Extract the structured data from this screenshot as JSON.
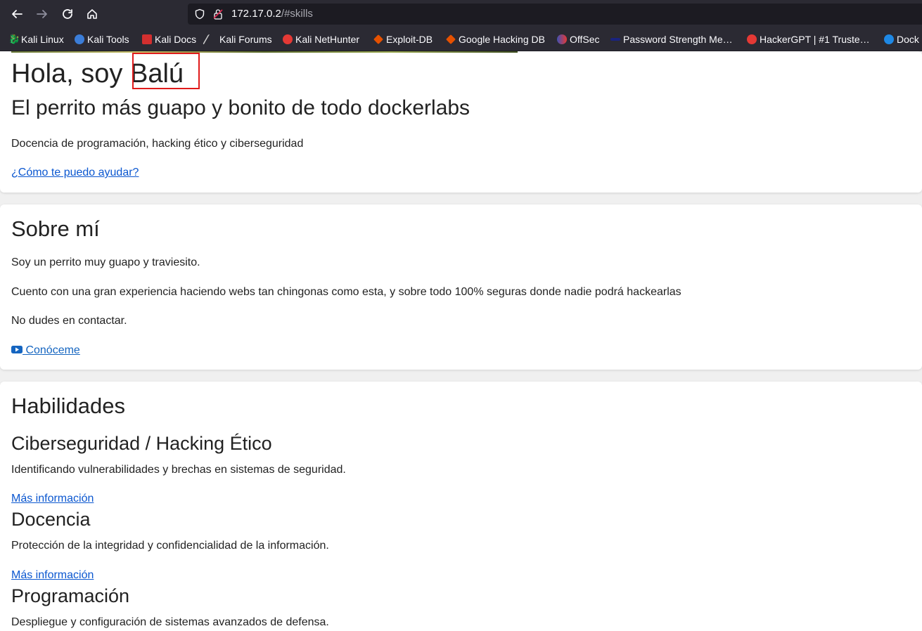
{
  "browser": {
    "url_host": "172.17.0.2",
    "url_path": "/#skills",
    "bookmarks": [
      {
        "label": "Kali Linux",
        "icon": "kali-dragon-icon",
        "color": "#c0c0c0"
      },
      {
        "label": "Kali Tools",
        "icon": "kali-tools-icon",
        "color": "#3b7dd8"
      },
      {
        "label": "Kali Docs",
        "icon": "kali-docs-icon",
        "color": "#d32f2f"
      },
      {
        "label": "Kali Forums",
        "icon": "kali-forums-icon",
        "color": "#c0c0c0"
      },
      {
        "label": "Kali NetHunter",
        "icon": "nethunter-icon",
        "color": "#e53935"
      },
      {
        "label": "Exploit-DB",
        "icon": "exploit-db-icon",
        "color": "#e65100"
      },
      {
        "label": "Google Hacking DB",
        "icon": "ghdb-icon",
        "color": "#e65100"
      },
      {
        "label": "OffSec",
        "icon": "offsec-icon",
        "color": "#3f51b5"
      },
      {
        "label": "Password Strength Me…",
        "icon": "password-meter-icon",
        "color": "#1a237e"
      },
      {
        "label": "HackerGPT | #1 Truste…",
        "icon": "hackergpt-icon",
        "color": "#e53935"
      },
      {
        "label": "Dock",
        "icon": "docker-icon",
        "color": "#1e88e5"
      }
    ]
  },
  "hero": {
    "greeting": "Hola, soy ",
    "name": "Balú",
    "subtitle": "El perrito más guapo y bonito de todo dockerlabs",
    "tagline": "Docencia de programación, hacking ético y ciberseguridad",
    "cta": "¿Cómo te puedo ayudar?"
  },
  "about": {
    "title": "Sobre mí",
    "p1": "Soy un perrito muy guapo y traviesito.",
    "p2": "Cuento con una gran experiencia haciendo webs tan chingonas como esta, y sobre todo 100% seguras donde nadie podrá hackearlas",
    "p3": "No dudes en contactar.",
    "link": " Conóceme",
    "link_icon": "youtube-icon"
  },
  "skills": {
    "title": "Habilidades",
    "items": [
      {
        "title": "Ciberseguridad / Hacking Ético",
        "desc": "Identificando vulnerabilidades y brechas en sistemas de seguridad.",
        "link": "Más información"
      },
      {
        "title": "Docencia",
        "desc": "Protección de la integridad y confidencialidad de la información.",
        "link": "Más información"
      },
      {
        "title": "Programación",
        "desc": "Despliegue y configuración de sistemas avanzados de defensa.",
        "link": ""
      }
    ]
  }
}
